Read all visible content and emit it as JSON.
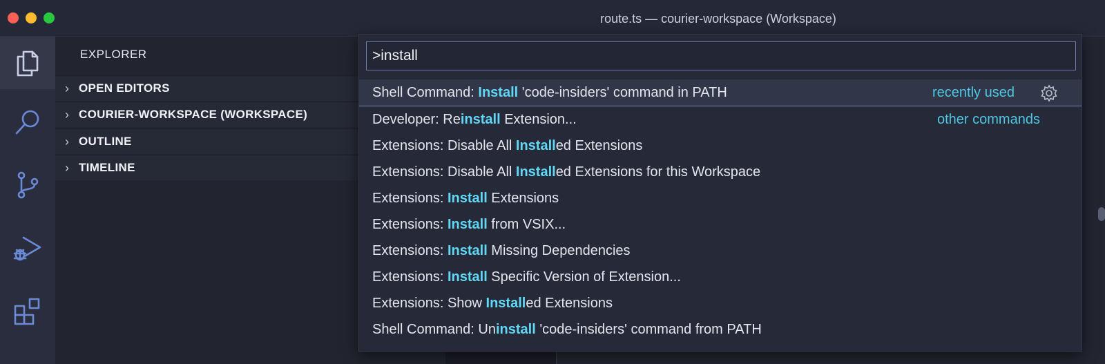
{
  "window": {
    "title": "route.ts — courier-workspace (Workspace)"
  },
  "activity_bar": [
    {
      "icon": "files-icon",
      "active": true
    },
    {
      "icon": "search-icon",
      "active": false
    },
    {
      "icon": "source-control-icon",
      "active": false
    },
    {
      "icon": "run-debug-icon",
      "active": false
    },
    {
      "icon": "extensions-icon",
      "active": false
    }
  ],
  "sidebar": {
    "title": "EXPLORER",
    "sections": [
      {
        "label": "OPEN EDITORS"
      },
      {
        "label": "COURIER-WORKSPACE (WORKSPACE)"
      },
      {
        "label": "OUTLINE"
      },
      {
        "label": "TIMELINE"
      }
    ]
  },
  "command_palette": {
    "query": ">install",
    "results": [
      {
        "pre": "Shell Command: ",
        "match": "Install",
        "post": " 'code-insiders' command in PATH",
        "badge": "recently used",
        "selected": true
      },
      {
        "pre": "Developer: Re",
        "match": "install",
        "post": " Extension...",
        "badge": "other commands",
        "selected": false
      },
      {
        "pre": "Extensions: Disable All ",
        "match": "Install",
        "post": "ed Extensions",
        "badge": "",
        "selected": false
      },
      {
        "pre": "Extensions: Disable All ",
        "match": "Install",
        "post": "ed Extensions for this Workspace",
        "badge": "",
        "selected": false
      },
      {
        "pre": "Extensions: ",
        "match": "Install",
        "post": " Extensions",
        "badge": "",
        "selected": false
      },
      {
        "pre": "Extensions: ",
        "match": "Install",
        "post": " from VSIX...",
        "badge": "",
        "selected": false
      },
      {
        "pre": "Extensions: ",
        "match": "Install",
        "post": " Missing Dependencies",
        "badge": "",
        "selected": false
      },
      {
        "pre": "Extensions: ",
        "match": "Install",
        "post": " Specific Version of Extension...",
        "badge": "",
        "selected": false
      },
      {
        "pre": "Extensions: Show ",
        "match": "Install",
        "post": "ed Extensions",
        "badge": "",
        "selected": false
      },
      {
        "pre": "Shell Command: Un",
        "match": "install",
        "post": " 'code-insiders' command from PATH",
        "badge": "",
        "selected": false
      }
    ],
    "gear_icon": "gear-icon",
    "colors": {
      "highlight": "#61d8f5",
      "badge": "#4fc8e4",
      "focus_border": "#6c7ea8"
    }
  }
}
